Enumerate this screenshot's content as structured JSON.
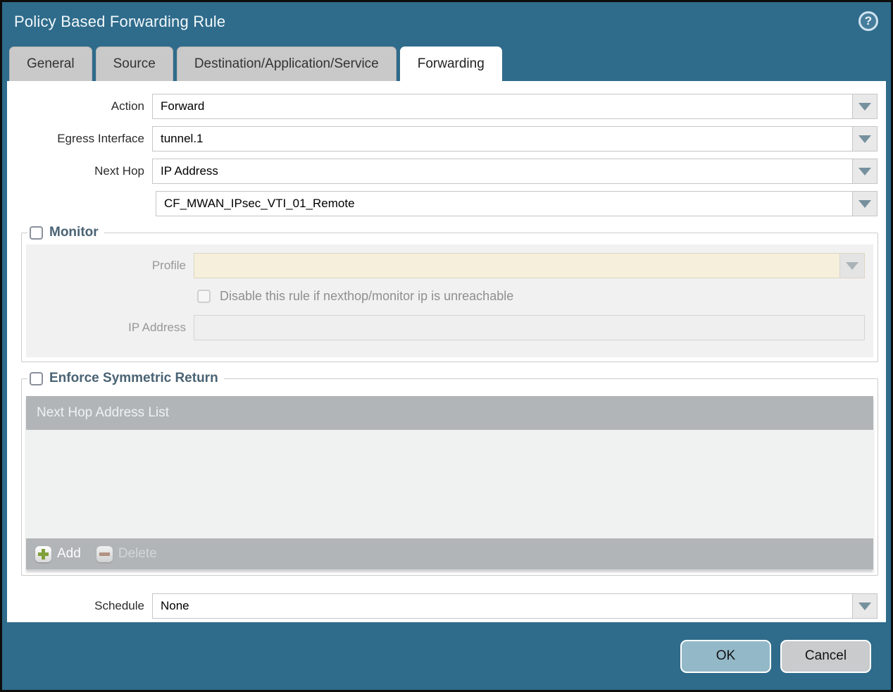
{
  "dialog": {
    "title": "Policy Based Forwarding Rule",
    "help_glyph": "?"
  },
  "tabs": [
    {
      "label": "General",
      "active": false
    },
    {
      "label": "Source",
      "active": false
    },
    {
      "label": "Destination/Application/Service",
      "active": false
    },
    {
      "label": "Forwarding",
      "active": true
    }
  ],
  "form": {
    "action": {
      "label": "Action",
      "value": "Forward"
    },
    "egress_interface": {
      "label": "Egress Interface",
      "value": "tunnel.1"
    },
    "next_hop": {
      "label": "Next Hop",
      "value": "IP Address"
    },
    "next_hop_address": {
      "value": "CF_MWAN_IPsec_VTI_01_Remote"
    },
    "schedule": {
      "label": "Schedule",
      "value": "None"
    }
  },
  "monitor": {
    "title": "Monitor",
    "checked": false,
    "profile": {
      "label": "Profile",
      "value": ""
    },
    "disable_rule": {
      "label": "Disable this rule if nexthop/monitor ip is unreachable",
      "checked": false
    },
    "ip_address": {
      "label": "IP Address",
      "value": ""
    }
  },
  "enforce_symmetric_return": {
    "title": "Enforce Symmetric Return",
    "checked": false,
    "table": {
      "header": "Next Hop Address List",
      "rows": [],
      "add_label": "Add",
      "delete_label": "Delete"
    }
  },
  "footer": {
    "ok_label": "OK",
    "cancel_label": "Cancel"
  },
  "colors": {
    "teal": "#2f6b8b",
    "tab-gray": "#c9c9c9",
    "section-header": "#4a6374",
    "table-gray": "#b1b5b8",
    "panel-gray": "#f1f1f1",
    "profile-beige": "#f6efdc",
    "ok-btn": "#93b9c9",
    "cancel-btn": "#c9cbcd",
    "add-green": "#7fa03a",
    "del-red": "#b18a78",
    "arrow": "#76909e"
  }
}
